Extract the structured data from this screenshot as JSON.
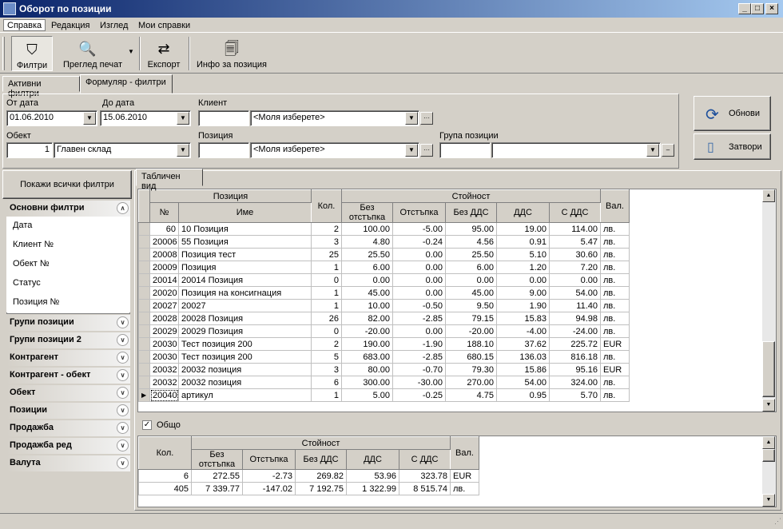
{
  "window": {
    "title": "Оборот по позиции"
  },
  "menu": [
    "Справка",
    "Редакция",
    "Изглед",
    "Мои справки"
  ],
  "toolbar": {
    "filters": "Филтри",
    "preview": "Преглед печат",
    "export": "Експорт",
    "info": "Инфо за позиция"
  },
  "tabs": {
    "active_filters": "Активни филтри",
    "form_filters": "Формуляр - филтри"
  },
  "filters": {
    "from_label": "От дата",
    "from_value": "01.06.2010",
    "to_label": "До дата",
    "to_value": "15.06.2010",
    "client_label": "Клиент",
    "client_code": "",
    "client_value": "<Моля изберете>",
    "object_label": "Обект",
    "object_code": "1",
    "object_value": "Главен склад",
    "position_label": "Позиция",
    "position_code": "",
    "position_value": "<Моля изберете>",
    "group_label": "Група позиции",
    "group_code": "",
    "group_value": ""
  },
  "buttons": {
    "refresh": "Обнови",
    "close": "Затвори"
  },
  "sidebar": {
    "show_all": "Покажи всички филтри",
    "main_group": "Основни филтри",
    "main_items": [
      "Дата",
      "Клиент №",
      "Обект №",
      "Статус",
      "Позиция №"
    ],
    "groups": [
      "Групи позиции",
      "Групи позиции 2",
      "Контрагент",
      "Контрагент - обект",
      "Обект",
      "Позиции",
      "Продажба",
      "Продажба ред",
      "Валута"
    ]
  },
  "view_tab": "Табличен вид",
  "table": {
    "h_position": "Позиция",
    "h_no": "№",
    "h_name": "Име",
    "h_qty": "Кол.",
    "h_value": "Стойност",
    "h_nodisc": "Без отстъпка",
    "h_disc": "Отстъпка",
    "h_novat": "Без ДДС",
    "h_vat": "ДДС",
    "h_withvat": "С ДДС",
    "h_cur": "Вал.",
    "rows": [
      [
        "60",
        "10 Позиция",
        "2",
        "100.00",
        "-5.00",
        "95.00",
        "19.00",
        "114.00",
        "лв."
      ],
      [
        "20006",
        "55 Позиция",
        "3",
        "4.80",
        "-0.24",
        "4.56",
        "0.91",
        "5.47",
        "лв."
      ],
      [
        "20008",
        "Позиция тест",
        "25",
        "25.50",
        "0.00",
        "25.50",
        "5.10",
        "30.60",
        "лв."
      ],
      [
        "20009",
        "Позиция",
        "1",
        "6.00",
        "0.00",
        "6.00",
        "1.20",
        "7.20",
        "лв."
      ],
      [
        "20014",
        "20014 Позиция",
        "0",
        "0.00",
        "0.00",
        "0.00",
        "0.00",
        "0.00",
        "лв."
      ],
      [
        "20020",
        "Позиция на консигнация",
        "1",
        "45.00",
        "0.00",
        "45.00",
        "9.00",
        "54.00",
        "лв."
      ],
      [
        "20027",
        "20027",
        "1",
        "10.00",
        "-0.50",
        "9.50",
        "1.90",
        "11.40",
        "лв."
      ],
      [
        "20028",
        "20028 Позиция",
        "26",
        "82.00",
        "-2.85",
        "79.15",
        "15.83",
        "94.98",
        "лв."
      ],
      [
        "20029",
        "20029 Позиция",
        "0",
        "-20.00",
        "0.00",
        "-20.00",
        "-4.00",
        "-24.00",
        "лв."
      ],
      [
        "20030",
        "Тест позиция 200",
        "2",
        "190.00",
        "-1.90",
        "188.10",
        "37.62",
        "225.72",
        "EUR"
      ],
      [
        "20030",
        "Тест позиция 200",
        "5",
        "683.00",
        "-2.85",
        "680.15",
        "136.03",
        "816.18",
        "лв."
      ],
      [
        "20032",
        "20032 позиция",
        "3",
        "80.00",
        "-0.70",
        "79.30",
        "15.86",
        "95.16",
        "EUR"
      ],
      [
        "20032",
        "20032 позиция",
        "6",
        "300.00",
        "-30.00",
        "270.00",
        "54.00",
        "324.00",
        "лв."
      ],
      [
        "20040",
        "артикул",
        "1",
        "5.00",
        "-0.25",
        "4.75",
        "0.95",
        "5.70",
        "лв."
      ]
    ]
  },
  "totals": {
    "checkbox_label": "Общо",
    "rows": [
      [
        "6",
        "272.55",
        "-2.73",
        "269.82",
        "53.96",
        "323.78",
        "EUR"
      ],
      [
        "405",
        "7 339.77",
        "-147.02",
        "7 192.75",
        "1 322.99",
        "8 515.74",
        "лв."
      ]
    ]
  }
}
